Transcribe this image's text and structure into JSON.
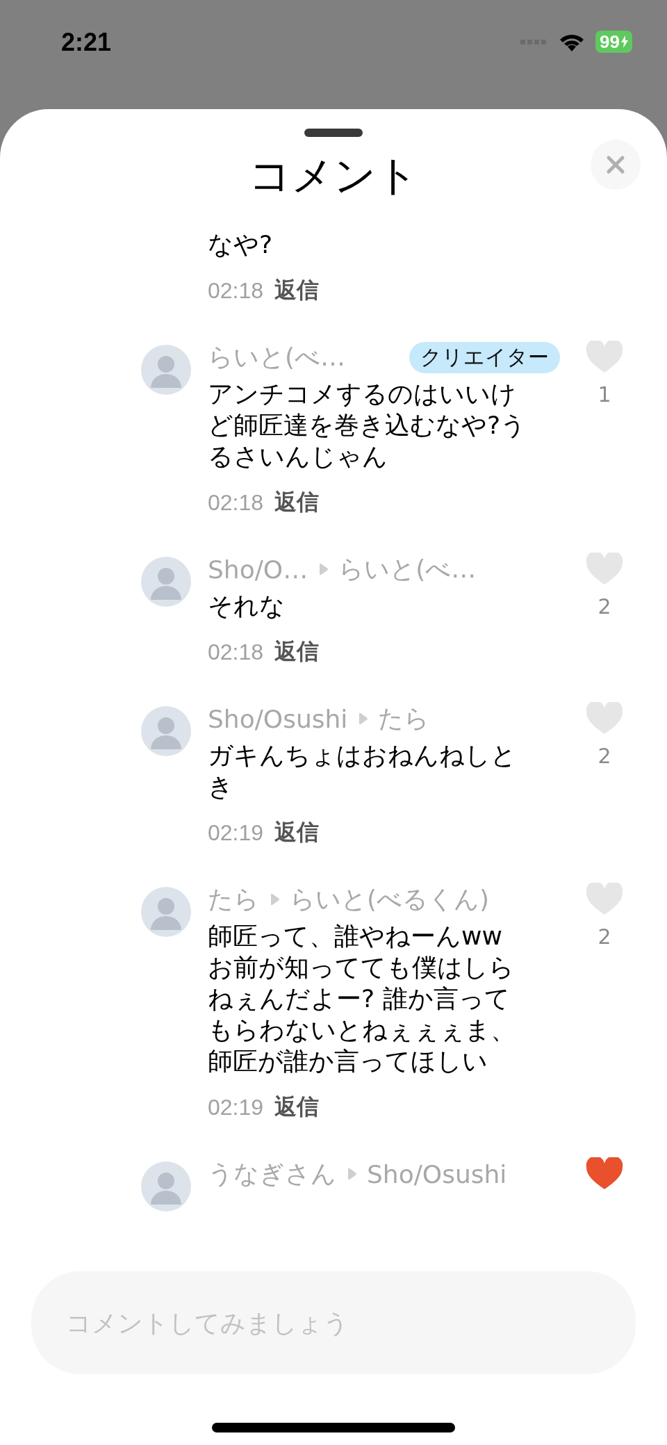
{
  "status_bar": {
    "time": "2:21",
    "battery": "99"
  },
  "sheet": {
    "title": "コメント"
  },
  "comments": [
    {
      "text": "なや?",
      "time": "02:18",
      "reply_label": "返信"
    },
    {
      "author": "らいと(べ…",
      "badge": "クリエイター",
      "text": "アンチコメするのはいいけど師匠達を巻き込むなや?うるさいんじゃん",
      "time": "02:18",
      "reply_label": "返信",
      "likes": "1",
      "liked": false
    },
    {
      "author": "Sho/O…",
      "reply_to": "らいと(べ…",
      "text": "それな",
      "time": "02:18",
      "reply_label": "返信",
      "likes": "2",
      "liked": false
    },
    {
      "author": "Sho/Osushi",
      "reply_to": "たら",
      "text": "ガキんちょはおねんねしとき",
      "time": "02:19",
      "reply_label": "返信",
      "likes": "2",
      "liked": false
    },
    {
      "author": "たら",
      "reply_to": "らいと(べるくん)",
      "text": "師匠って、誰やねーんwwお前が知ってても僕はしらねぇんだよー? 誰か言ってもらわないとねぇぇぇま、師匠が誰か言ってほしい",
      "time": "02:19",
      "reply_label": "返信",
      "likes": "2",
      "liked": false
    },
    {
      "author": "うなぎさん",
      "reply_to": "Sho/Osushi",
      "liked": true
    }
  ],
  "comment_input": {
    "placeholder": "コメントしてみましょう"
  }
}
